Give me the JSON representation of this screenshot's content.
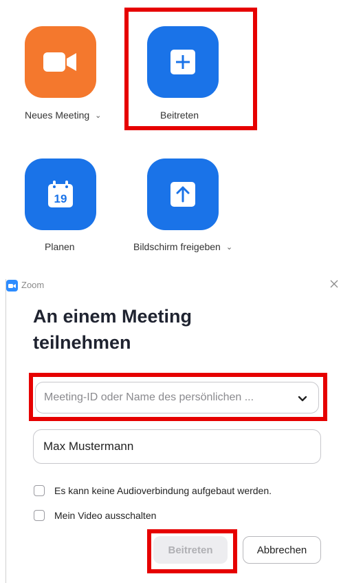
{
  "home": {
    "tiles": [
      {
        "label": "Neues Meeting",
        "icon": "video-camera-icon",
        "color": "#f4782d",
        "has_dropdown": true
      },
      {
        "label": "Beitreten",
        "icon": "plus-icon",
        "color": "#1a73e8",
        "has_dropdown": false
      },
      {
        "label": "Planen",
        "icon": "calendar-icon",
        "calendar_day": "19",
        "color": "#1a73e8",
        "has_dropdown": false
      },
      {
        "label": "Bildschirm freigeben",
        "icon": "upload-arrow-icon",
        "color": "#1a73e8",
        "has_dropdown": true
      }
    ]
  },
  "dialog": {
    "app_name": "Zoom",
    "title_line1": "An einem Meeting",
    "title_line2": "teilnehmen",
    "meeting_id_placeholder": "Meeting-ID oder Name des persönlichen ...",
    "name_value": "Max Mustermann",
    "checkbox_audio": "Es kann keine Audioverbindung aufgebaut werden.",
    "checkbox_video": "Mein Video ausschalten",
    "join_button": "Beitreten",
    "cancel_button": "Abbrechen"
  },
  "colors": {
    "highlight": "#e60000",
    "zoom_blue": "#1a73e8",
    "zoom_orange": "#f4782d"
  }
}
